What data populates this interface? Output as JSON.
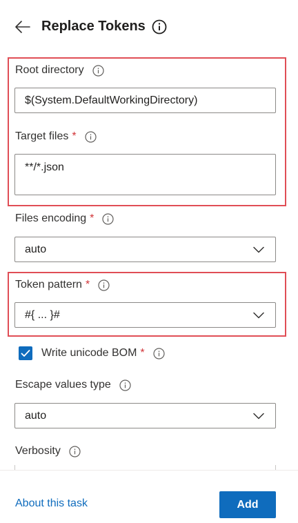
{
  "header": {
    "title": "Replace Tokens",
    "back_icon": "arrow-left-icon",
    "info_icon": "info-circle-icon"
  },
  "fields": {
    "root_directory": {
      "label": "Root directory",
      "value": "$(System.DefaultWorkingDirectory)"
    },
    "target_files": {
      "label": "Target files",
      "required_marker": "*",
      "value": "**/*.json"
    },
    "files_encoding": {
      "label": "Files encoding",
      "required_marker": "*",
      "value": "auto"
    },
    "token_pattern": {
      "label": "Token pattern",
      "required_marker": "*",
      "value": "#{ ... }#"
    },
    "write_unicode_bom": {
      "label": "Write unicode BOM",
      "required_marker": "*",
      "checked": true
    },
    "escape_values_type": {
      "label": "Escape values type",
      "value": "auto"
    },
    "verbosity": {
      "label": "Verbosity"
    }
  },
  "footer": {
    "about_link": "About this task",
    "add_button": "Add"
  },
  "colors": {
    "accent": "#0f6cbd",
    "required": "#d13438",
    "highlight": "#e04d55",
    "border": "#8a8886"
  }
}
